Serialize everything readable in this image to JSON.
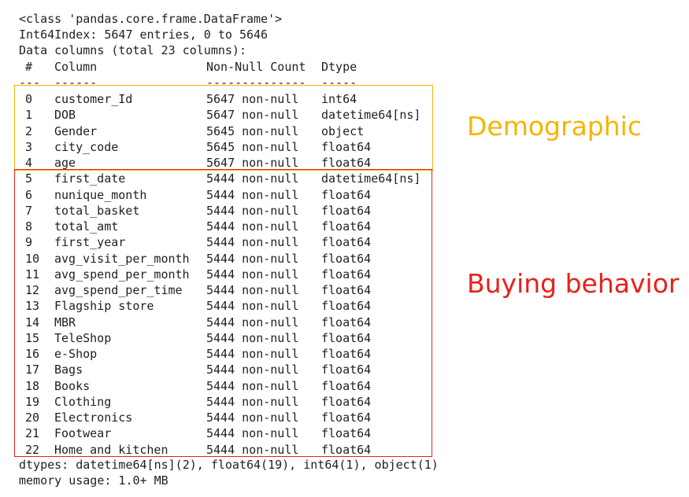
{
  "header": {
    "class_line": "<class 'pandas.core.frame.DataFrame'>",
    "index_line": "Int64Index: 5647 entries, 0 to 5646",
    "columns_line": "Data columns (total 23 columns):"
  },
  "table_header": {
    "idx": "#",
    "column": "Column",
    "count": "Non-Null Count",
    "dtype": "Dtype",
    "idx_rule": "---",
    "column_rule": "------",
    "count_rule": "--------------",
    "dtype_rule": "-----"
  },
  "rows": [
    {
      "idx": "0",
      "column": "customer_Id",
      "count": "5647 non-null",
      "dtype": "int64"
    },
    {
      "idx": "1",
      "column": "DOB",
      "count": "5647 non-null",
      "dtype": "datetime64[ns]"
    },
    {
      "idx": "2",
      "column": "Gender",
      "count": "5645 non-null",
      "dtype": "object"
    },
    {
      "idx": "3",
      "column": "city_code",
      "count": "5645 non-null",
      "dtype": "float64"
    },
    {
      "idx": "4",
      "column": "age",
      "count": "5647 non-null",
      "dtype": "float64"
    },
    {
      "idx": "5",
      "column": "first_date",
      "count": "5444 non-null",
      "dtype": "datetime64[ns]"
    },
    {
      "idx": "6",
      "column": "nunique_month",
      "count": "5444 non-null",
      "dtype": "float64"
    },
    {
      "idx": "7",
      "column": "total_basket",
      "count": "5444 non-null",
      "dtype": "float64"
    },
    {
      "idx": "8",
      "column": "total_amt",
      "count": "5444 non-null",
      "dtype": "float64"
    },
    {
      "idx": "9",
      "column": "first_year",
      "count": "5444 non-null",
      "dtype": "float64"
    },
    {
      "idx": "10",
      "column": "avg_visit_per_month",
      "count": "5444 non-null",
      "dtype": "float64"
    },
    {
      "idx": "11",
      "column": "avg_spend_per_month",
      "count": "5444 non-null",
      "dtype": "float64"
    },
    {
      "idx": "12",
      "column": "avg_spend_per_time",
      "count": "5444 non-null",
      "dtype": "float64"
    },
    {
      "idx": "13",
      "column": "Flagship store",
      "count": "5444 non-null",
      "dtype": "float64"
    },
    {
      "idx": "14",
      "column": "MBR",
      "count": "5444 non-null",
      "dtype": "float64"
    },
    {
      "idx": "15",
      "column": "TeleShop",
      "count": "5444 non-null",
      "dtype": "float64"
    },
    {
      "idx": "16",
      "column": "e-Shop",
      "count": "5444 non-null",
      "dtype": "float64"
    },
    {
      "idx": "17",
      "column": "Bags",
      "count": "5444 non-null",
      "dtype": "float64"
    },
    {
      "idx": "18",
      "column": "Books",
      "count": "5444 non-null",
      "dtype": "float64"
    },
    {
      "idx": "19",
      "column": "Clothing",
      "count": "5444 non-null",
      "dtype": "float64"
    },
    {
      "idx": "20",
      "column": "Electronics",
      "count": "5444 non-null",
      "dtype": "float64"
    },
    {
      "idx": "21",
      "column": "Footwear",
      "count": "5444 non-null",
      "dtype": "float64"
    },
    {
      "idx": "22",
      "column": "Home and kitchen",
      "count": "5444 non-null",
      "dtype": "float64"
    }
  ],
  "footer": {
    "dtypes_line": "dtypes: datetime64[ns](2), float64(19), int64(1), object(1)",
    "memory_line": "memory usage: 1.0+ MB"
  },
  "annotations": {
    "demographic_label": "Demographic",
    "demographic_color": "#f5b400",
    "buying_label": "Buying behavior",
    "buying_color": "#e8211b"
  }
}
